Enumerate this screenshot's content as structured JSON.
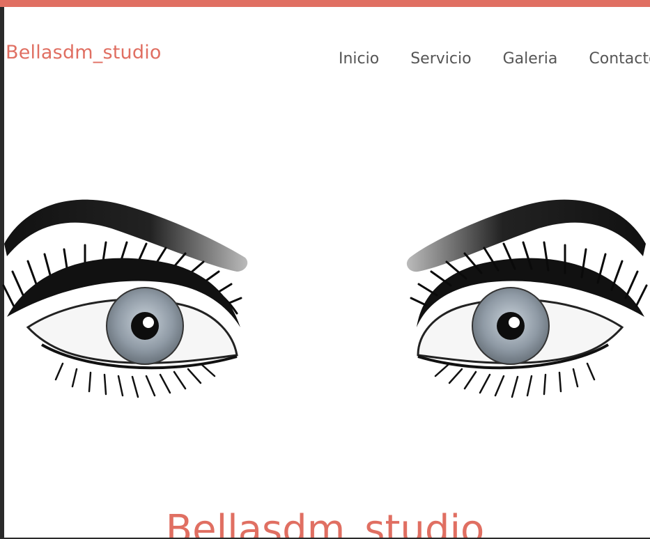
{
  "header": {
    "brand": "Bellasdm_studio"
  },
  "nav": {
    "items": [
      {
        "label": "Inicio"
      },
      {
        "label": "Servicio"
      },
      {
        "label": "Galeria"
      },
      {
        "label": "Contacto"
      }
    ]
  },
  "hero": {
    "title": "Bellasdm_studio"
  },
  "colors": {
    "accent": "#e06f62",
    "nav_text": "#555555",
    "background": "#ffffff"
  }
}
